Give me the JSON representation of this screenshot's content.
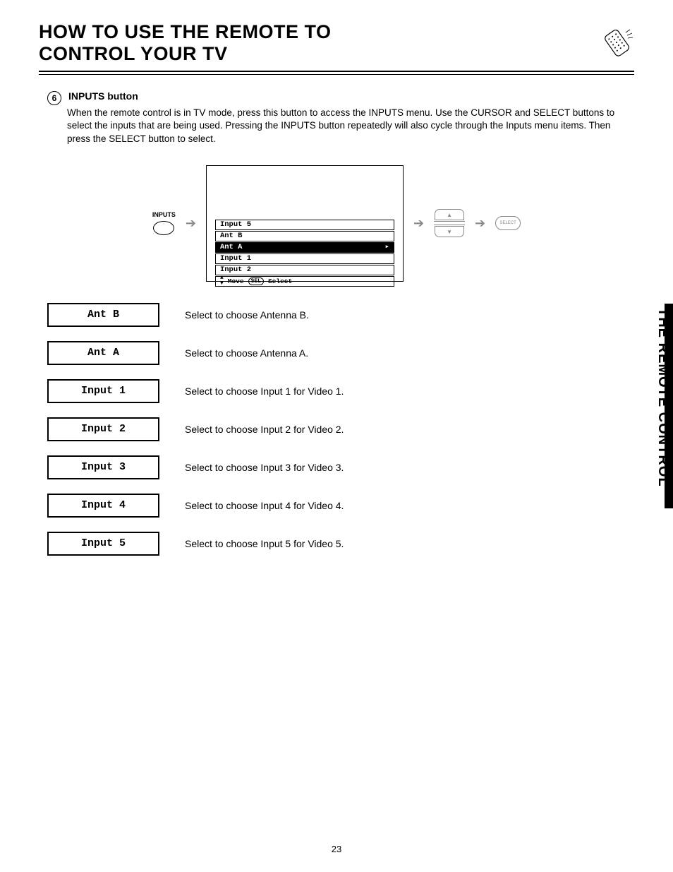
{
  "header": {
    "title": "HOW TO USE THE REMOTE TO CONTROL YOUR TV"
  },
  "side_tab": "THE REMOTE CONTROL",
  "page_number": "23",
  "section": {
    "number": "6",
    "title": "INPUTS button",
    "body": "When the remote control is in TV mode, press this button to access the INPUTS menu.  Use the CURSOR and SELECT buttons to select the inputs that are being used.  Pressing the INPUTS button repeatedly will also cycle through the Inputs menu items.  Then press the SELECT button to select."
  },
  "flow": {
    "inputs_label": "INPUTS",
    "menu_items": [
      "Input 5",
      "Ant B",
      "Ant A",
      "Input 1",
      "Input 2"
    ],
    "menu_selected_index": 2,
    "menu_arrow": "▸",
    "footer_move": "Move",
    "footer_sel": "SEL",
    "footer_select": "Select",
    "select_btn_label": "SELECT"
  },
  "options": [
    {
      "label": "Ant B",
      "desc": "Select to choose Antenna B."
    },
    {
      "label": "Ant A",
      "desc": "Select to choose Antenna A."
    },
    {
      "label": "Input 1",
      "desc": "Select to choose Input 1 for Video 1."
    },
    {
      "label": "Input 2",
      "desc": "Select to choose Input 2 for Video 2."
    },
    {
      "label": "Input 3",
      "desc": "Select to choose Input 3 for Video 3."
    },
    {
      "label": "Input 4",
      "desc": "Select to choose Input 4 for Video 4."
    },
    {
      "label": "Input 5",
      "desc": "Select to choose Input 5 for Video 5."
    }
  ]
}
